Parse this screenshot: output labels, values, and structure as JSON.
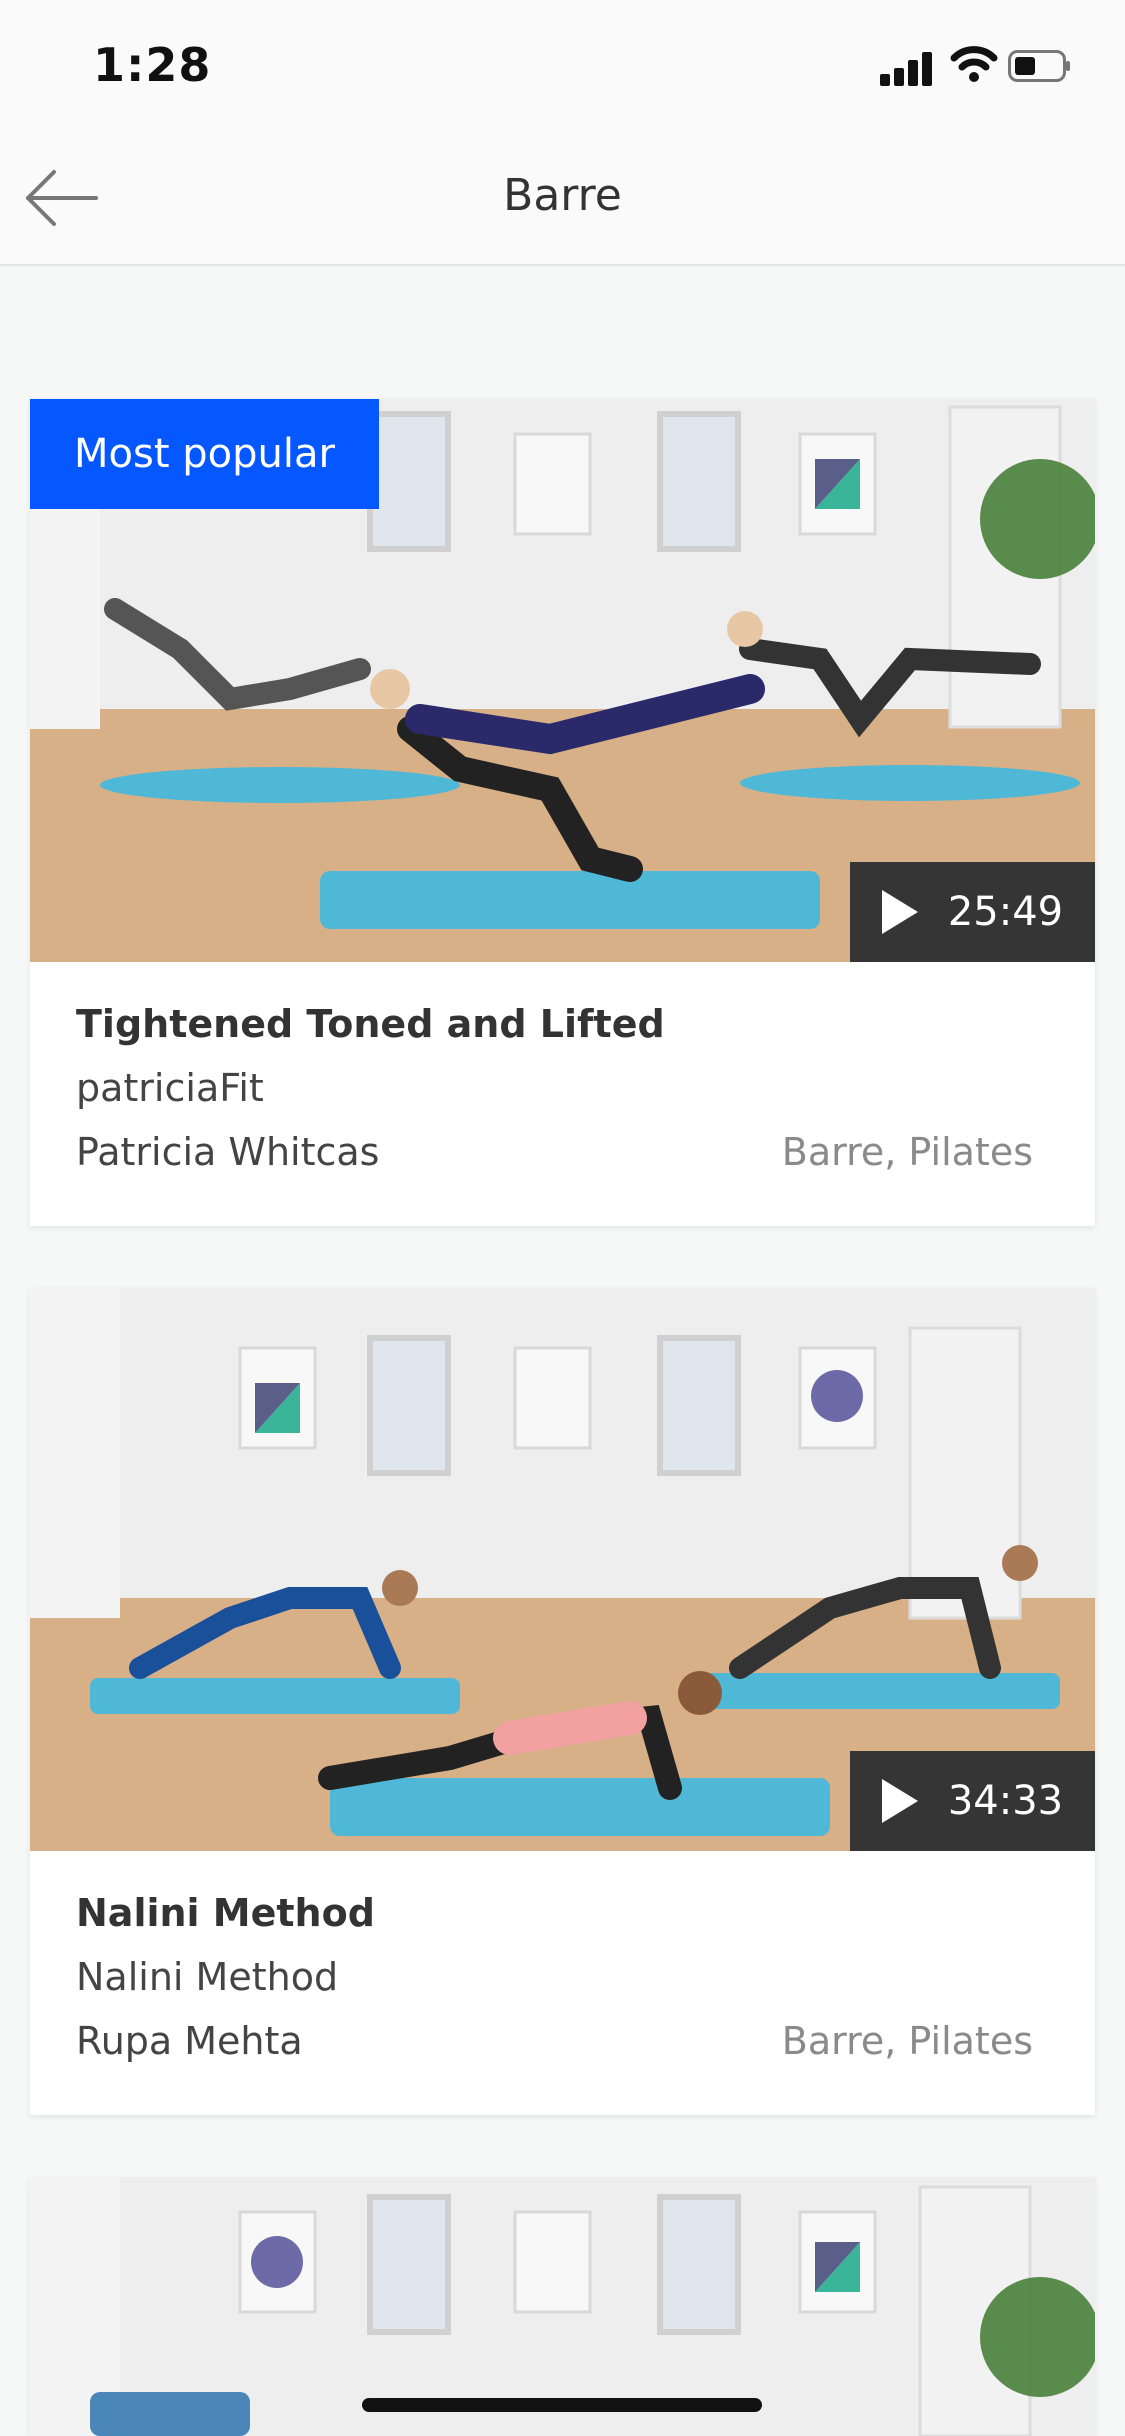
{
  "status": {
    "time": "1:28"
  },
  "header": {
    "title": "Barre"
  },
  "cards": [
    {
      "badge": "Most popular",
      "duration": "25:49",
      "title": "Tightened Toned and Lifted",
      "studio": "patriciaFit",
      "instructor": "Patricia Whitcas",
      "tags": "Barre, Pilates"
    },
    {
      "badge": "",
      "duration": "34:33",
      "title": "Nalini Method",
      "studio": "Nalini Method",
      "instructor": "Rupa Mehta",
      "tags": "Barre, Pilates"
    }
  ],
  "colors": {
    "accent": "#0557ff",
    "mat": "#4fb8d6",
    "floor": "#d9b28a"
  }
}
